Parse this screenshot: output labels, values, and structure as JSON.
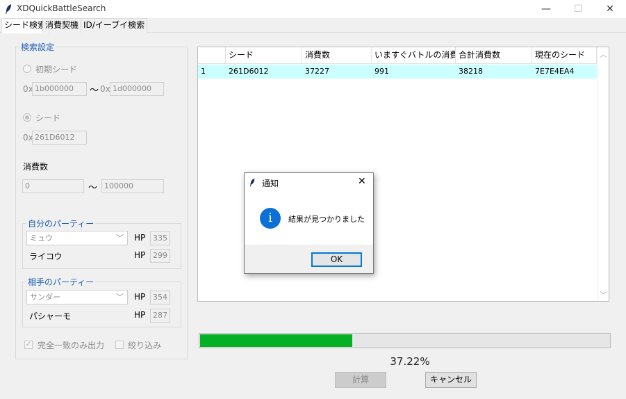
{
  "window": {
    "title": "XDQuickBattleSearch",
    "min_glyph": "—",
    "max_glyph": "☐",
    "close_glyph": "✕"
  },
  "tabs": [
    "シード検索",
    "消費契機",
    "ID/イーブイ検索"
  ],
  "search_settings": {
    "title": "検索設定",
    "initial_seed": {
      "label": "初期シード",
      "prefix": "0x",
      "from": "1b000000",
      "tilde": "〜",
      "to": "1d000000"
    },
    "seed": {
      "label": "シード",
      "prefix": "0x",
      "value": "261D6012"
    },
    "consumption": {
      "label": "消費数",
      "from": "0",
      "tilde": "〜",
      "to": "100000"
    },
    "my_party": {
      "title": "自分のパーティー",
      "slot1": "ミュウ",
      "hp_label": "HP",
      "hp1": "335",
      "slot2": "ライコウ",
      "hp2": "299"
    },
    "opponent_party": {
      "title": "相手のパーティー",
      "slot1": "サンダー",
      "hp_label": "HP",
      "hp1": "354",
      "slot2": "パシャーモ",
      "hp2": "287"
    },
    "exact_match_label": "完全一致のみ出力",
    "exact_match_checked": true,
    "filter_label": "絞り込み",
    "filter_checked": false
  },
  "results": {
    "columns": [
      "",
      "シード",
      "消費数",
      "いますぐバトルの消費数",
      "合計消費数",
      "現在のシード"
    ],
    "rows": [
      [
        "1",
        "261D6012",
        "37227",
        "991",
        "38218",
        "7E7E4EA4"
      ]
    ],
    "row_highlight": "#ccffff"
  },
  "progress": {
    "fraction": 0.3722,
    "label": "37.22%",
    "color": "#06b025"
  },
  "buttons": {
    "calculate": "計算",
    "cancel": "キャンセル"
  },
  "dialog": {
    "title": "通知",
    "close_glyph": "✕",
    "icon": "info-icon",
    "message": "結果が見つかりました",
    "ok": "OK"
  }
}
